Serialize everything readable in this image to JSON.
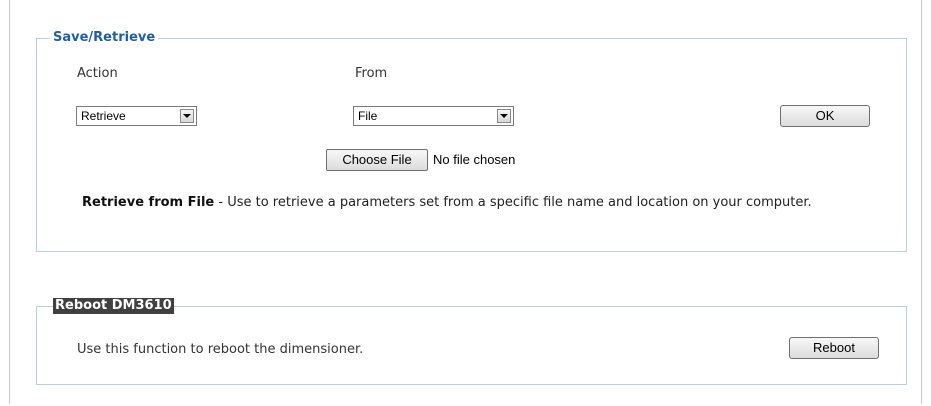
{
  "save_retrieve": {
    "title": "Save/Retrieve",
    "action_label": "Action",
    "from_label": "From",
    "action_value": "Retrieve",
    "from_value": "File",
    "ok_label": "OK",
    "choose_file_label": "Choose File",
    "no_file_text": "No file chosen",
    "desc_bold": "Retrieve from File",
    "desc_text": " - Use to retrieve a parameters set from a specific file name and location on your computer."
  },
  "reboot": {
    "title": "Reboot DM3610",
    "text": "Use this function to reboot the dimensioner.",
    "button_label": "Reboot"
  },
  "colors": {
    "title_blue": "#1f5fa8",
    "panel_border": "#b9cfe4",
    "reboot_title_bg": "#404040"
  }
}
